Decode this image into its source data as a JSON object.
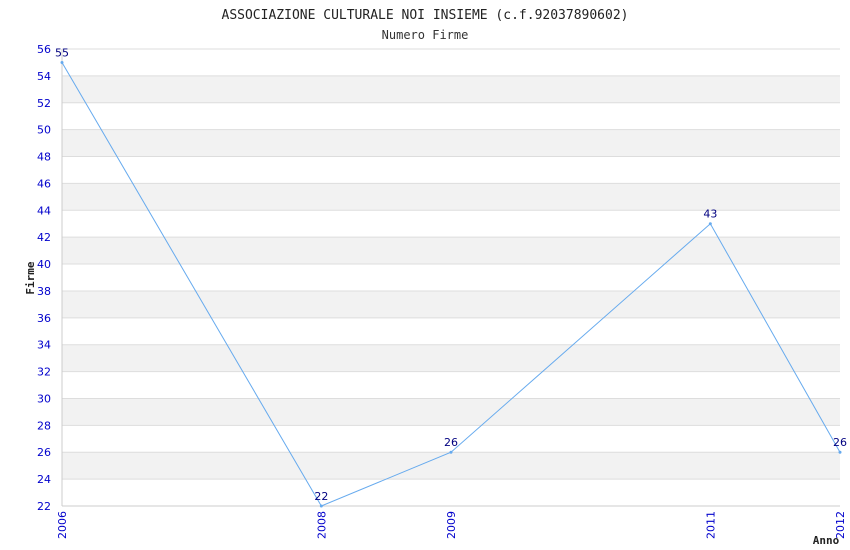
{
  "chart_data": {
    "type": "line",
    "title": "ASSOCIAZIONE CULTURALE NOI INSIEME (c.f.92037890602)",
    "subtitle": "Numero Firme",
    "xlabel": "Anno",
    "ylabel": "Firme",
    "x": [
      "2006",
      "2008",
      "2009",
      "2011",
      "2012"
    ],
    "series": [
      {
        "values": [
          55,
          22,
          26,
          43,
          26
        ]
      }
    ],
    "ylim": [
      22,
      56
    ],
    "ytick_step": 2,
    "grid": true,
    "colors": {
      "line": "#66aaee",
      "band": "#f2f2f2",
      "grid": "#dddddd",
      "tick_text": "#0000cc",
      "data_label": "#000080"
    }
  }
}
